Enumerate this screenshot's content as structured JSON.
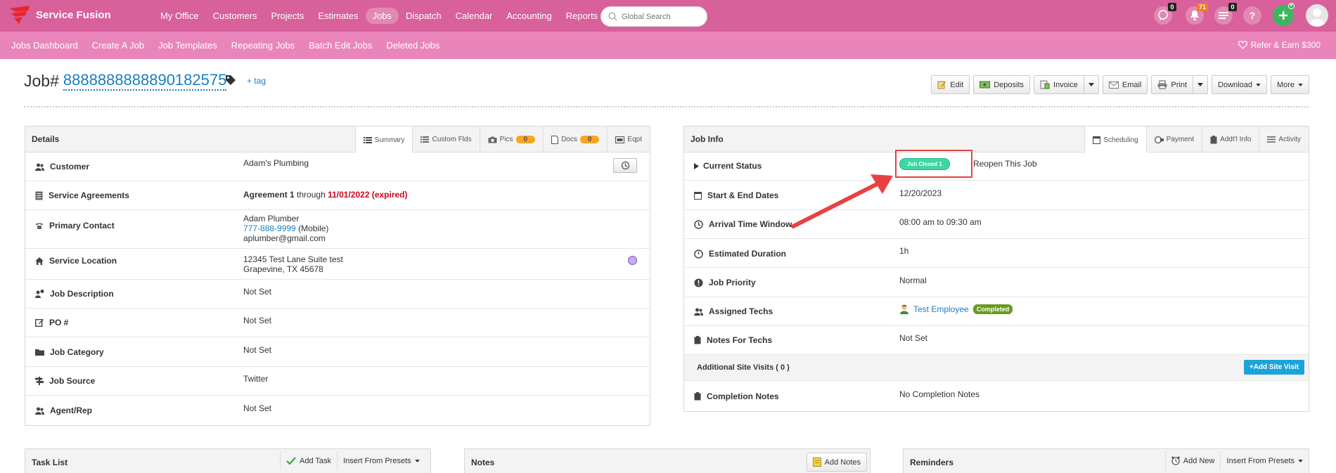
{
  "app": {
    "name": "Service Fusion"
  },
  "nav": {
    "items": [
      "My Office",
      "Customers",
      "Projects",
      "Estimates",
      "Jobs",
      "Dispatch",
      "Calendar",
      "Accounting",
      "Reports"
    ],
    "active_index": 4,
    "search_placeholder": "Global Search",
    "badges": {
      "chat": "0",
      "alerts": "71",
      "tasks": "0"
    },
    "help": "?"
  },
  "subnav": {
    "items": [
      "Jobs Dashboard",
      "Create A Job",
      "Job Templates",
      "Repeating Jobs",
      "Batch Edit Jobs",
      "Deleted Jobs"
    ],
    "refer": "Refer & Earn $300"
  },
  "job": {
    "prefix": "Job#",
    "number": "8888888888890182575",
    "add_tag": "+ tag"
  },
  "actions": {
    "edit": "Edit",
    "deposits": "Deposits",
    "invoice": "Invoice",
    "email": "Email",
    "print": "Print",
    "download": "Download",
    "more": "More"
  },
  "details": {
    "title": "Details",
    "tabs": {
      "summary": "Summary",
      "custom": "Custom Flds",
      "pics": "Pics",
      "pics_count": "0",
      "docs": "Docs",
      "docs_count": "0",
      "eqpt": "Eqpt"
    },
    "rows": {
      "customer_label": "Customer",
      "customer": "Adam's Plumbing",
      "agreements_label": "Service Agreements",
      "agreement_name": "Agreement 1",
      "agreement_through": "through",
      "agreement_date": "11/01/2022 (expired)",
      "contact_label": "Primary Contact",
      "contact_name": "Adam Plumber",
      "contact_phone": "777-888-9999",
      "contact_phone_type": "(Mobile)",
      "contact_email": "aplumber@gmail.com",
      "location_label": "Service Location",
      "location_line1": "12345 Test Lane Suite test",
      "location_line2": "Grapevine, TX 45678",
      "description_label": "Job Description",
      "description": "Not Set",
      "po_label": "PO #",
      "po": "Not Set",
      "category_label": "Job Category",
      "category": "Not Set",
      "source_label": "Job Source",
      "source": "Twitter",
      "agent_label": "Agent/Rep",
      "agent": "Not Set"
    }
  },
  "jobinfo": {
    "title": "Job Info",
    "tabs": {
      "scheduling": "Scheduling",
      "payment": "Payment",
      "addtl": "Addt'l Info",
      "activity": "Activity"
    },
    "rows": {
      "status_label": "Current Status",
      "status": "Job Closed 1",
      "reopen": "Reopen This Job",
      "dates_label": "Start & End Dates",
      "dates": "12/20/2023",
      "arrival_label": "Arrival Time Window",
      "arrival": "08:00 am to 09:30 am",
      "duration_label": "Estimated Duration",
      "duration": "1h",
      "priority_label": "Job Priority",
      "priority": "Normal",
      "techs_label": "Assigned Techs",
      "tech": "Test Employee",
      "tech_status": "Completed",
      "notes_label": "Notes For Techs",
      "notes": "Not Set",
      "visits_label": "Additional Site Visits ( 0 )",
      "add_visit": "Add Site Visit",
      "completion_label": "Completion Notes",
      "completion": "No Completion Notes"
    }
  },
  "bottom": {
    "tasks": {
      "title": "Task List",
      "add": "Add Task",
      "presets": "Insert From Presets"
    },
    "notes": {
      "title": "Notes",
      "add": "Add Notes"
    },
    "reminders": {
      "title": "Reminders",
      "add": "Add New",
      "presets": "Insert From Presets"
    }
  },
  "colors": {
    "nav": "#d8609b",
    "subnav": "#ea85bb",
    "link": "#1a7fc1",
    "status": "#3ed6a5",
    "highlight": "#e84141"
  }
}
